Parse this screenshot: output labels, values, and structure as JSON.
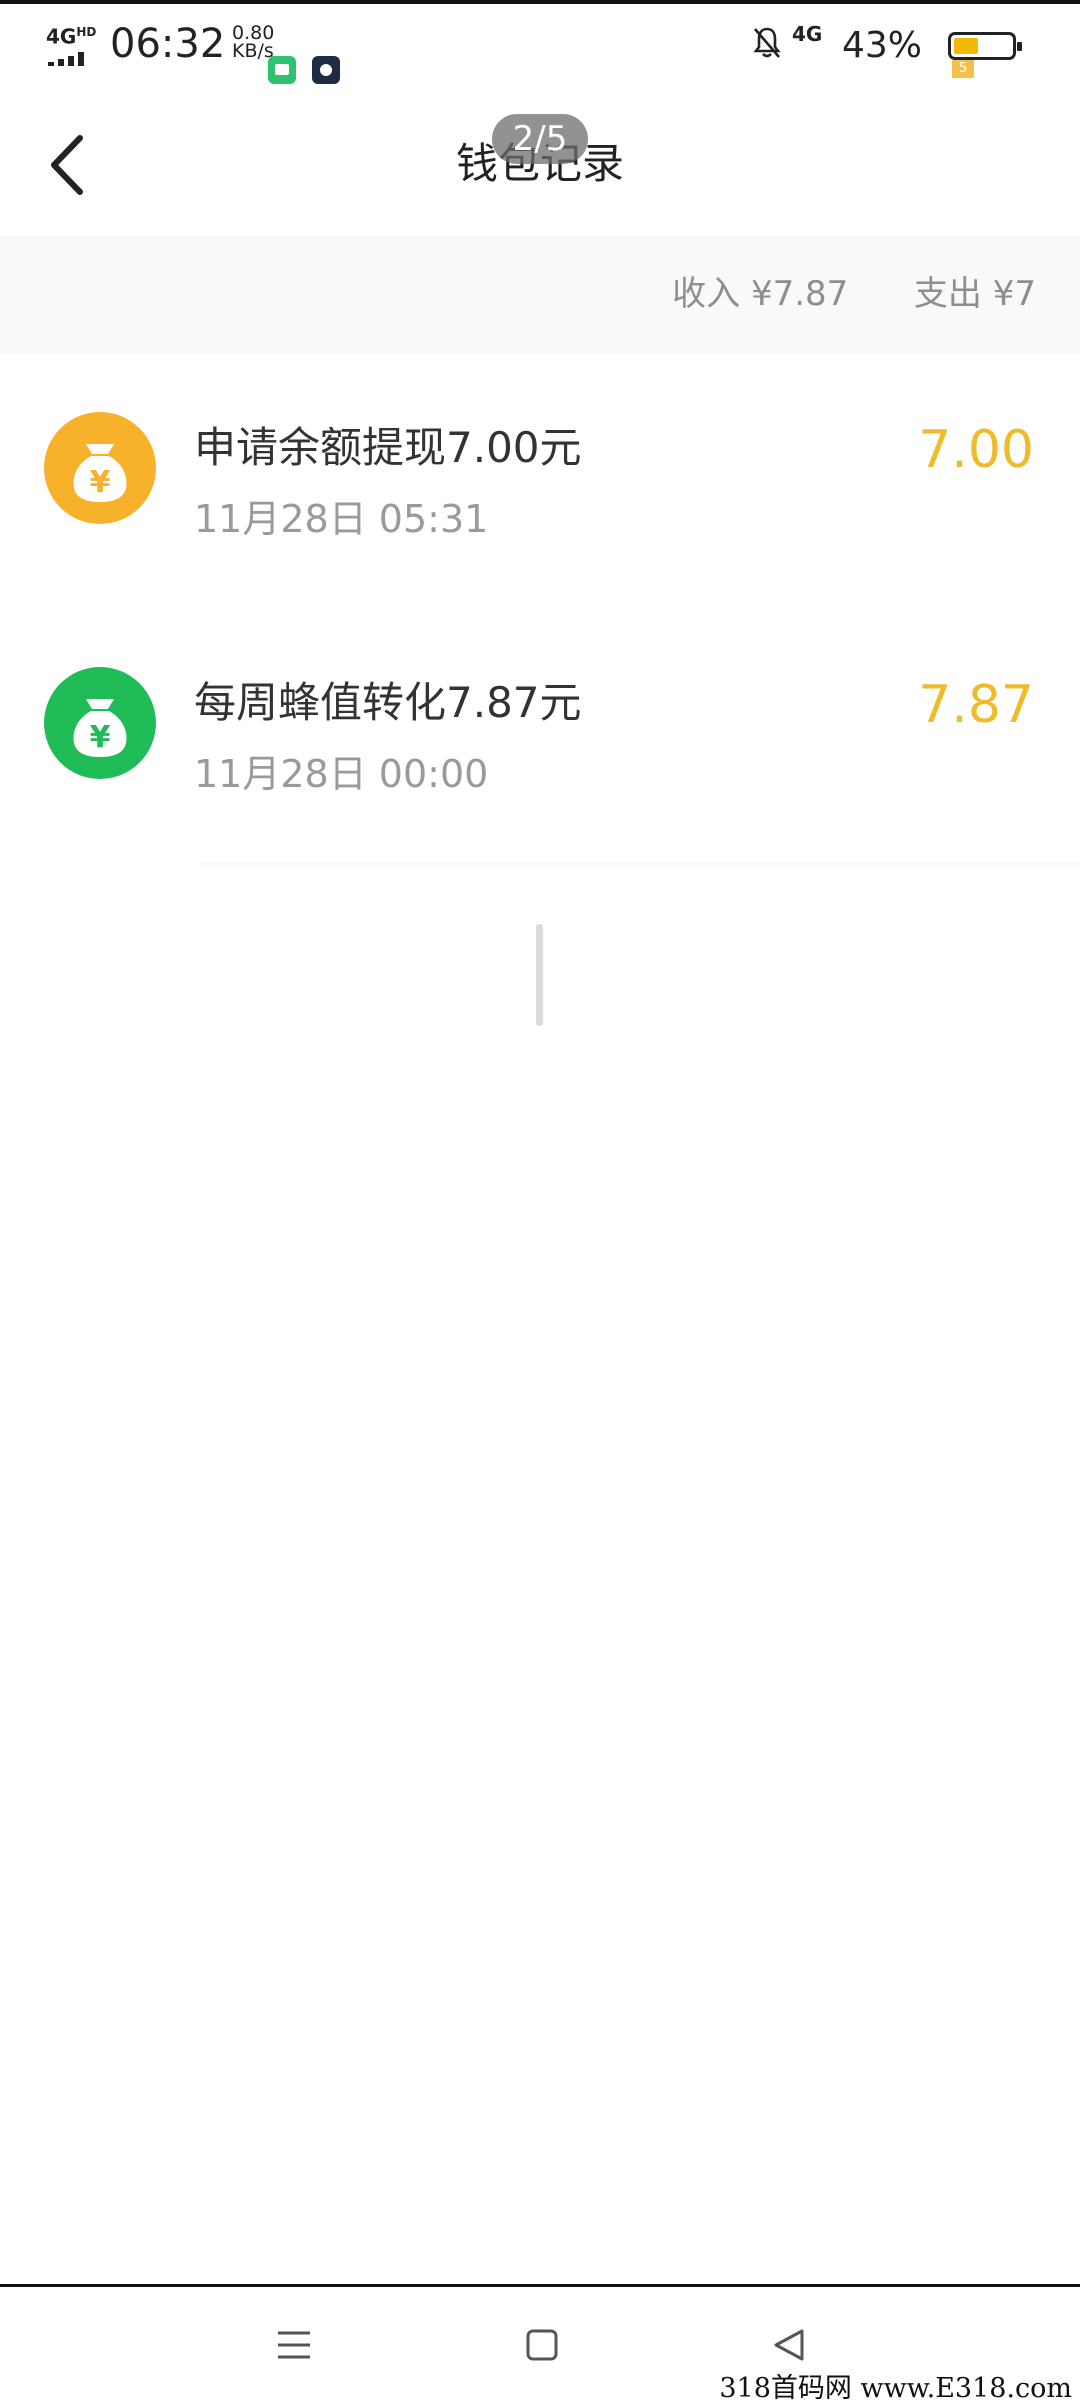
{
  "status_bar": {
    "network_label": "4G",
    "network_sup": "HD",
    "time": "06:32",
    "speed_value": "0.80",
    "speed_unit": "KB/s",
    "network_right": "4G",
    "battery_percent_text": "43%",
    "battery_level": 0.43,
    "battery_badge": "5",
    "battery_color": "#f2b90a"
  },
  "header": {
    "title": "钱包记录",
    "page_indicator": "2/5"
  },
  "summary": {
    "income_label": "收入",
    "income_value": "¥7.87",
    "expense_label": "支出",
    "expense_value": "¥7"
  },
  "records": [
    {
      "title": "申请余额提现7.00元",
      "date": "11月28日 05:31",
      "amount": "7.00",
      "icon": "money-bag-icon",
      "icon_color": "#f7b12b"
    },
    {
      "title": "每周蜂值转化7.87元",
      "date": "11月28日 00:00",
      "amount": "7.87",
      "icon": "money-bag-icon",
      "icon_color": "#1fbc57"
    }
  ],
  "accent_color": "#f0bb2a",
  "watermark": "318首码网 www.E318.com"
}
